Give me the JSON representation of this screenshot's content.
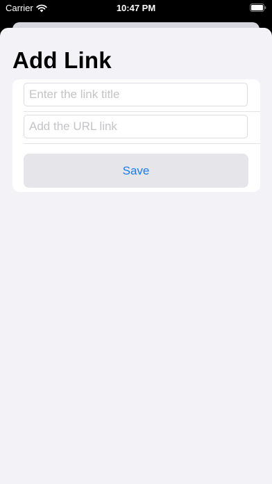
{
  "status_bar": {
    "carrier": "Carrier",
    "time": "10:47 PM",
    "wifi_icon": "wifi-icon",
    "battery_icon": "battery-icon"
  },
  "page": {
    "title": "Add Link"
  },
  "form": {
    "title_field": {
      "value": "",
      "placeholder": "Enter the link title"
    },
    "url_field": {
      "value": "",
      "placeholder": "Add the URL link"
    },
    "save_label": "Save"
  },
  "colors": {
    "accent": "#1a7bf2",
    "background": "#f2f2f7",
    "button_fill": "#e6e6ea"
  }
}
